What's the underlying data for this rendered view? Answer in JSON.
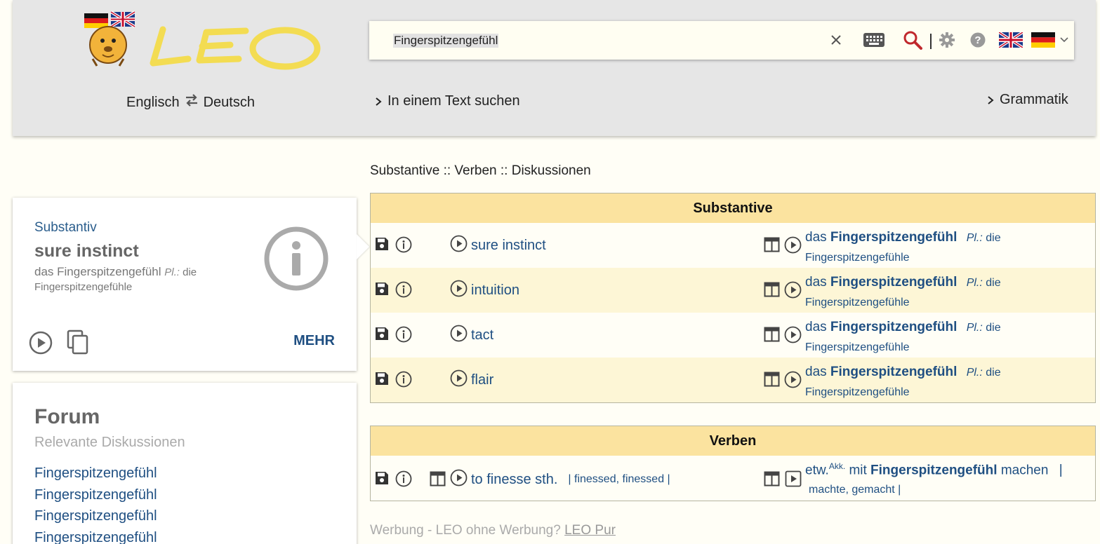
{
  "header": {
    "logo_text": "LEO",
    "search_value": "Fingerspitzengefühl",
    "lang_from": "Englisch",
    "lang_to": "Deutsch",
    "nav_text_search": "In einem Text suchen",
    "nav_grammar": "Grammatik",
    "icons": [
      "close-icon",
      "keyboard-icon",
      "search-icon",
      "settings-icon",
      "help-icon",
      "flag-uk-icon",
      "flag-de-icon",
      "chevron-down-icon"
    ]
  },
  "breadcrumb": "Substantive :: Verben :: Diskussionen",
  "card": {
    "pos": "Substantiv",
    "headword": "sure instinct",
    "translation_prefix": "das Fingerspitzengefühl",
    "plural_label": "Pl.:",
    "plural_article": "die",
    "plural_word": "Fingerspitzengefühle",
    "more_label": "MEHR"
  },
  "forum": {
    "title": "Forum",
    "subtitle": "Relevante Diskussionen",
    "links": [
      "Fingerspitzengefühl",
      "Fingerspitzengefühl",
      "Fingerspitzengefühl",
      "Fingerspitzengefühl"
    ]
  },
  "nouns": {
    "title": "Substantive",
    "rows": [
      {
        "en": "sure instinct",
        "de_article": "das",
        "de_word": "Fingerspitzengefühl",
        "pl_label": "Pl.:",
        "pl_article": "die",
        "pl_word": "Fingerspitzengefühle"
      },
      {
        "en": "intuition",
        "de_article": "das",
        "de_word": "Fingerspitzengefühl",
        "pl_label": "Pl.:",
        "pl_article": "die",
        "pl_word": "Fingerspitzengefühle"
      },
      {
        "en": "tact",
        "de_article": "das",
        "de_word": "Fingerspitzengefühl",
        "pl_label": "Pl.:",
        "pl_article": "die",
        "pl_word": "Fingerspitzengefühle"
      },
      {
        "en": "flair",
        "de_article": "das",
        "de_word": "Fingerspitzengefühl",
        "pl_label": "Pl.:",
        "pl_article": "die",
        "pl_word": "Fingerspitzengefühle"
      }
    ]
  },
  "verbs": {
    "title": "Verben",
    "rows": [
      {
        "en": "to finesse sth.",
        "en_forms": "| finessed, finessed |",
        "de_pre": "etw.",
        "de_case": "Akk.",
        "de_mid": "mit",
        "de_word": "Fingerspitzengefühl",
        "de_post": "machen",
        "de_sep": "|",
        "de_forms": "machte, gemacht |"
      }
    ]
  },
  "ad": {
    "text": "Werbung - LEO ohne Werbung?",
    "link": "LEO Pur"
  },
  "colors": {
    "header_bg": "#e6e6e6",
    "table_head": "#fbe39f",
    "row_alt": "#fdf6d6",
    "link_blue": "#1f4f82",
    "search_red": "#c0282d"
  }
}
